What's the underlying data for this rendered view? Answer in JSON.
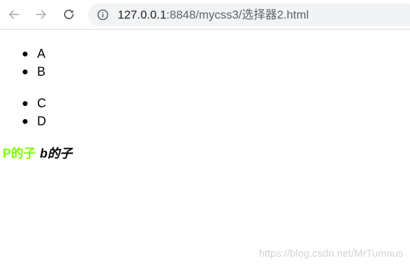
{
  "browser": {
    "url_host": "127.0.0.1",
    "url_rest": ":8848/mycss3/选择器2.html",
    "icons": {
      "back": "back-arrow-icon",
      "forward": "forward-arrow-icon",
      "reload": "reload-icon",
      "info": "info-icon"
    }
  },
  "page": {
    "list1": [
      "A",
      "B"
    ],
    "list2": [
      "C",
      "D"
    ],
    "p_text": "P的子",
    "b_text": "b的子",
    "colors": {
      "p_text": "#7cfc00",
      "b_text": "#000000"
    }
  },
  "watermark": "https://blog.csdn.net/MrTumnus"
}
